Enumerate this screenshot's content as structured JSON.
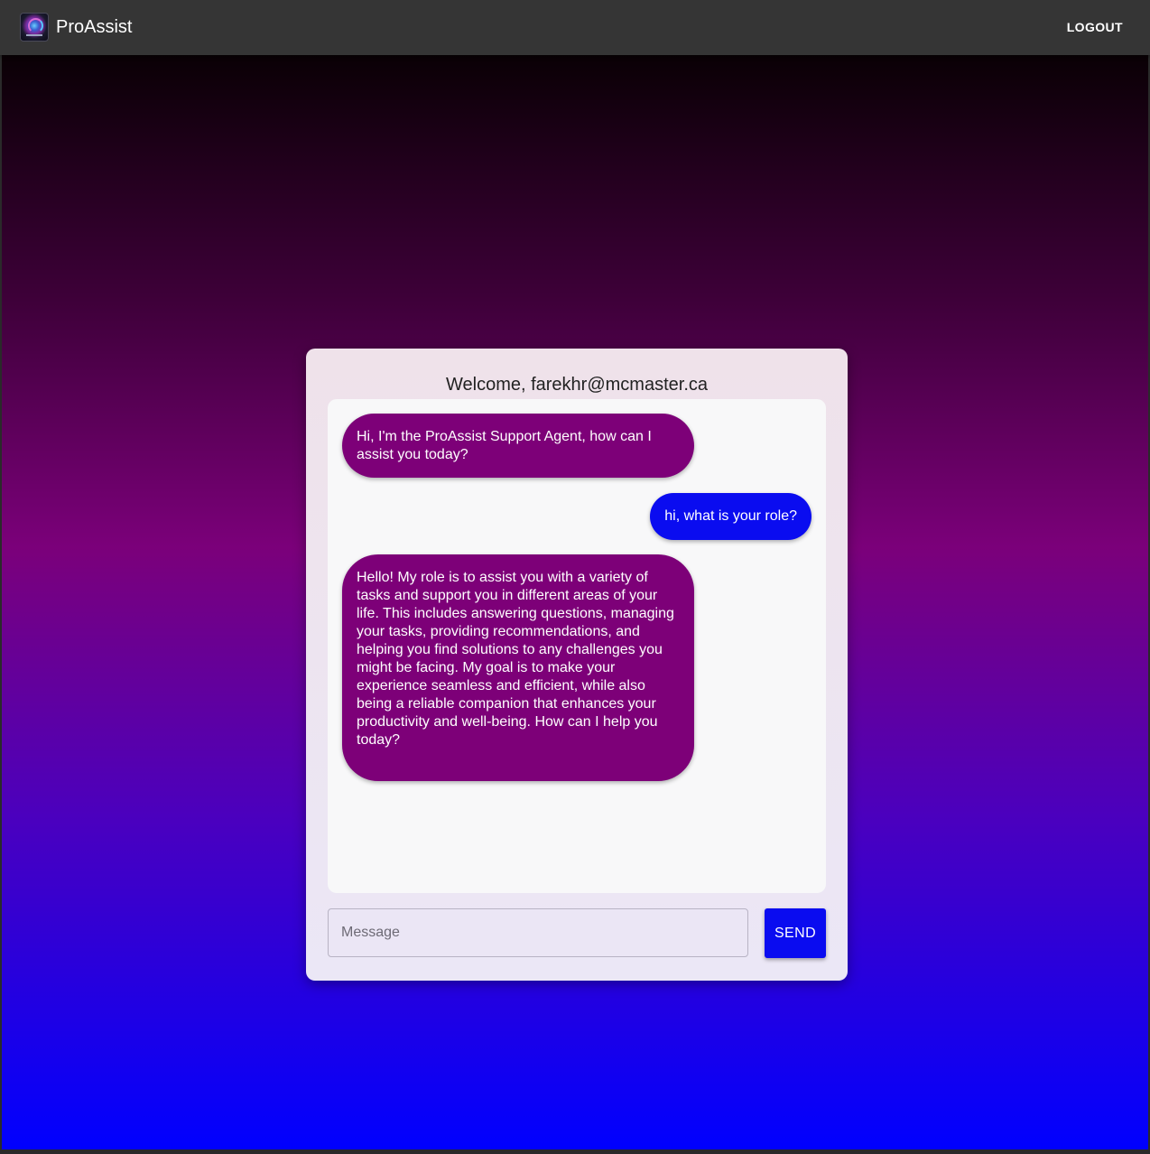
{
  "appbar": {
    "brand": "ProAssist",
    "logo_icon": "proassist-logo-icon",
    "logout_label": "LOGOUT"
  },
  "colors": {
    "appbar_bg": "#353535",
    "agent_bubble": "#7d0078",
    "user_bubble": "#0a0cf0",
    "send_button": "#0a0cf0",
    "background_gradient": [
      "#0a0005",
      "#3d0038",
      "#7b007a",
      "#4a00bf",
      "#0000ff"
    ]
  },
  "chat": {
    "welcome": "Welcome, farekhr@mcmaster.ca",
    "messages": [
      {
        "sender": "agent",
        "text": "Hi, I'm the ProAssist Support Agent, how can I assist you today?"
      },
      {
        "sender": "user",
        "text": "hi, what is your role?"
      },
      {
        "sender": "agent",
        "text": "Hello! My role is to assist you with a variety of tasks and support you in different areas of your life. This includes answering questions, managing your tasks, providing recommendations, and helping you find solutions to any challenges you might be facing. My goal is to make your experience seamless and efficient, while also being a reliable companion that enhances your productivity and well-being. How can I help you today?"
      }
    ],
    "input_placeholder": "Message",
    "input_value": "",
    "send_label": "SEND"
  }
}
